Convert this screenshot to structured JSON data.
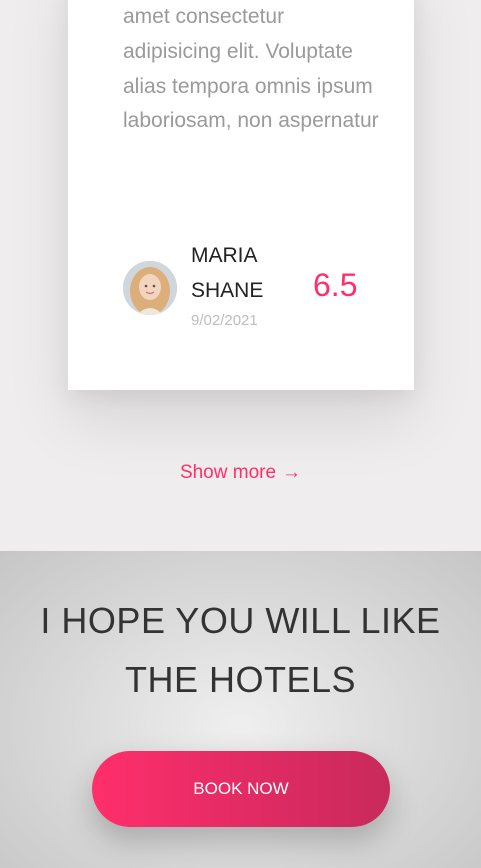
{
  "review": {
    "text": "amet consectetur adipisicing elit. Voluptate alias tempora omnis ipsum laboriosam, non aspernatur",
    "name": "MARIA SHANE",
    "date": "9/02/2021",
    "score": "6.5"
  },
  "show_more": {
    "label": "Show more",
    "arrow": "→"
  },
  "cta": {
    "title": "I HOPE YOU WILL LIKE THE HOTELS",
    "button_label": "BOOK NOW"
  },
  "colors": {
    "accent": "#ff2f6b",
    "card": "#ffffff",
    "page_bg": "#efedee",
    "cta_bg": "#d8d8d8"
  }
}
